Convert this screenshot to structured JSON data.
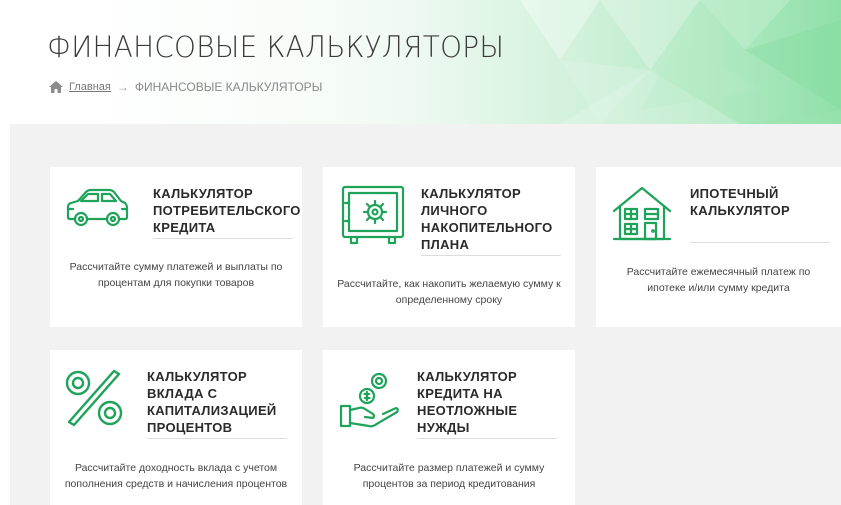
{
  "header": {
    "title": "ФИНАНСОВЫЕ КАЛЬКУЛЯТОРЫ",
    "breadcrumb": {
      "home_icon": "home-icon",
      "home_label": "Главная",
      "separator": "→",
      "current": "ФИНАНСОВЫЕ КАЛЬКУЛЯТОРЫ"
    },
    "accent_color": "#3cc46a"
  },
  "cards": [
    {
      "icon": "car-icon",
      "title": "КАЛЬКУЛЯТОР ПОТРЕБИТЕЛЬСКОГО КРЕДИТА",
      "description": "Рассчитайте сумму платежей и выплаты по процентам для покупки товаров"
    },
    {
      "icon": "safe-icon",
      "title": "КАЛЬКУЛЯТОР ЛИЧНОГО НАКОПИТЕЛЬНОГО ПЛАНА",
      "description": "Рассчитайте, как накопить желаемую сумму к определенному сроку"
    },
    {
      "icon": "house-icon",
      "title": "ИПОТЕЧНЫЙ КАЛЬКУЛЯТОР",
      "description": "Рассчитайте ежемесячный платеж по ипотеке и/или сумму кредита"
    },
    {
      "icon": "percent-icon",
      "title": "КАЛЬКУЛЯТОР ВКЛАДА С КАПИТАЛИЗАЦИЕЙ ПРОЦЕНТОВ",
      "description": "Рассчитайте доходность вклада с учетом пополнения средств и начисления процентов"
    },
    {
      "icon": "hand-coins-icon",
      "title": "КАЛЬКУЛЯТОР КРЕДИТА НА НЕОТЛОЖНЫЕ НУЖДЫ",
      "description": "Рассчитайте размер платежей и сумму процентов за период кредитования"
    }
  ],
  "icon_color": "#1fa35a"
}
